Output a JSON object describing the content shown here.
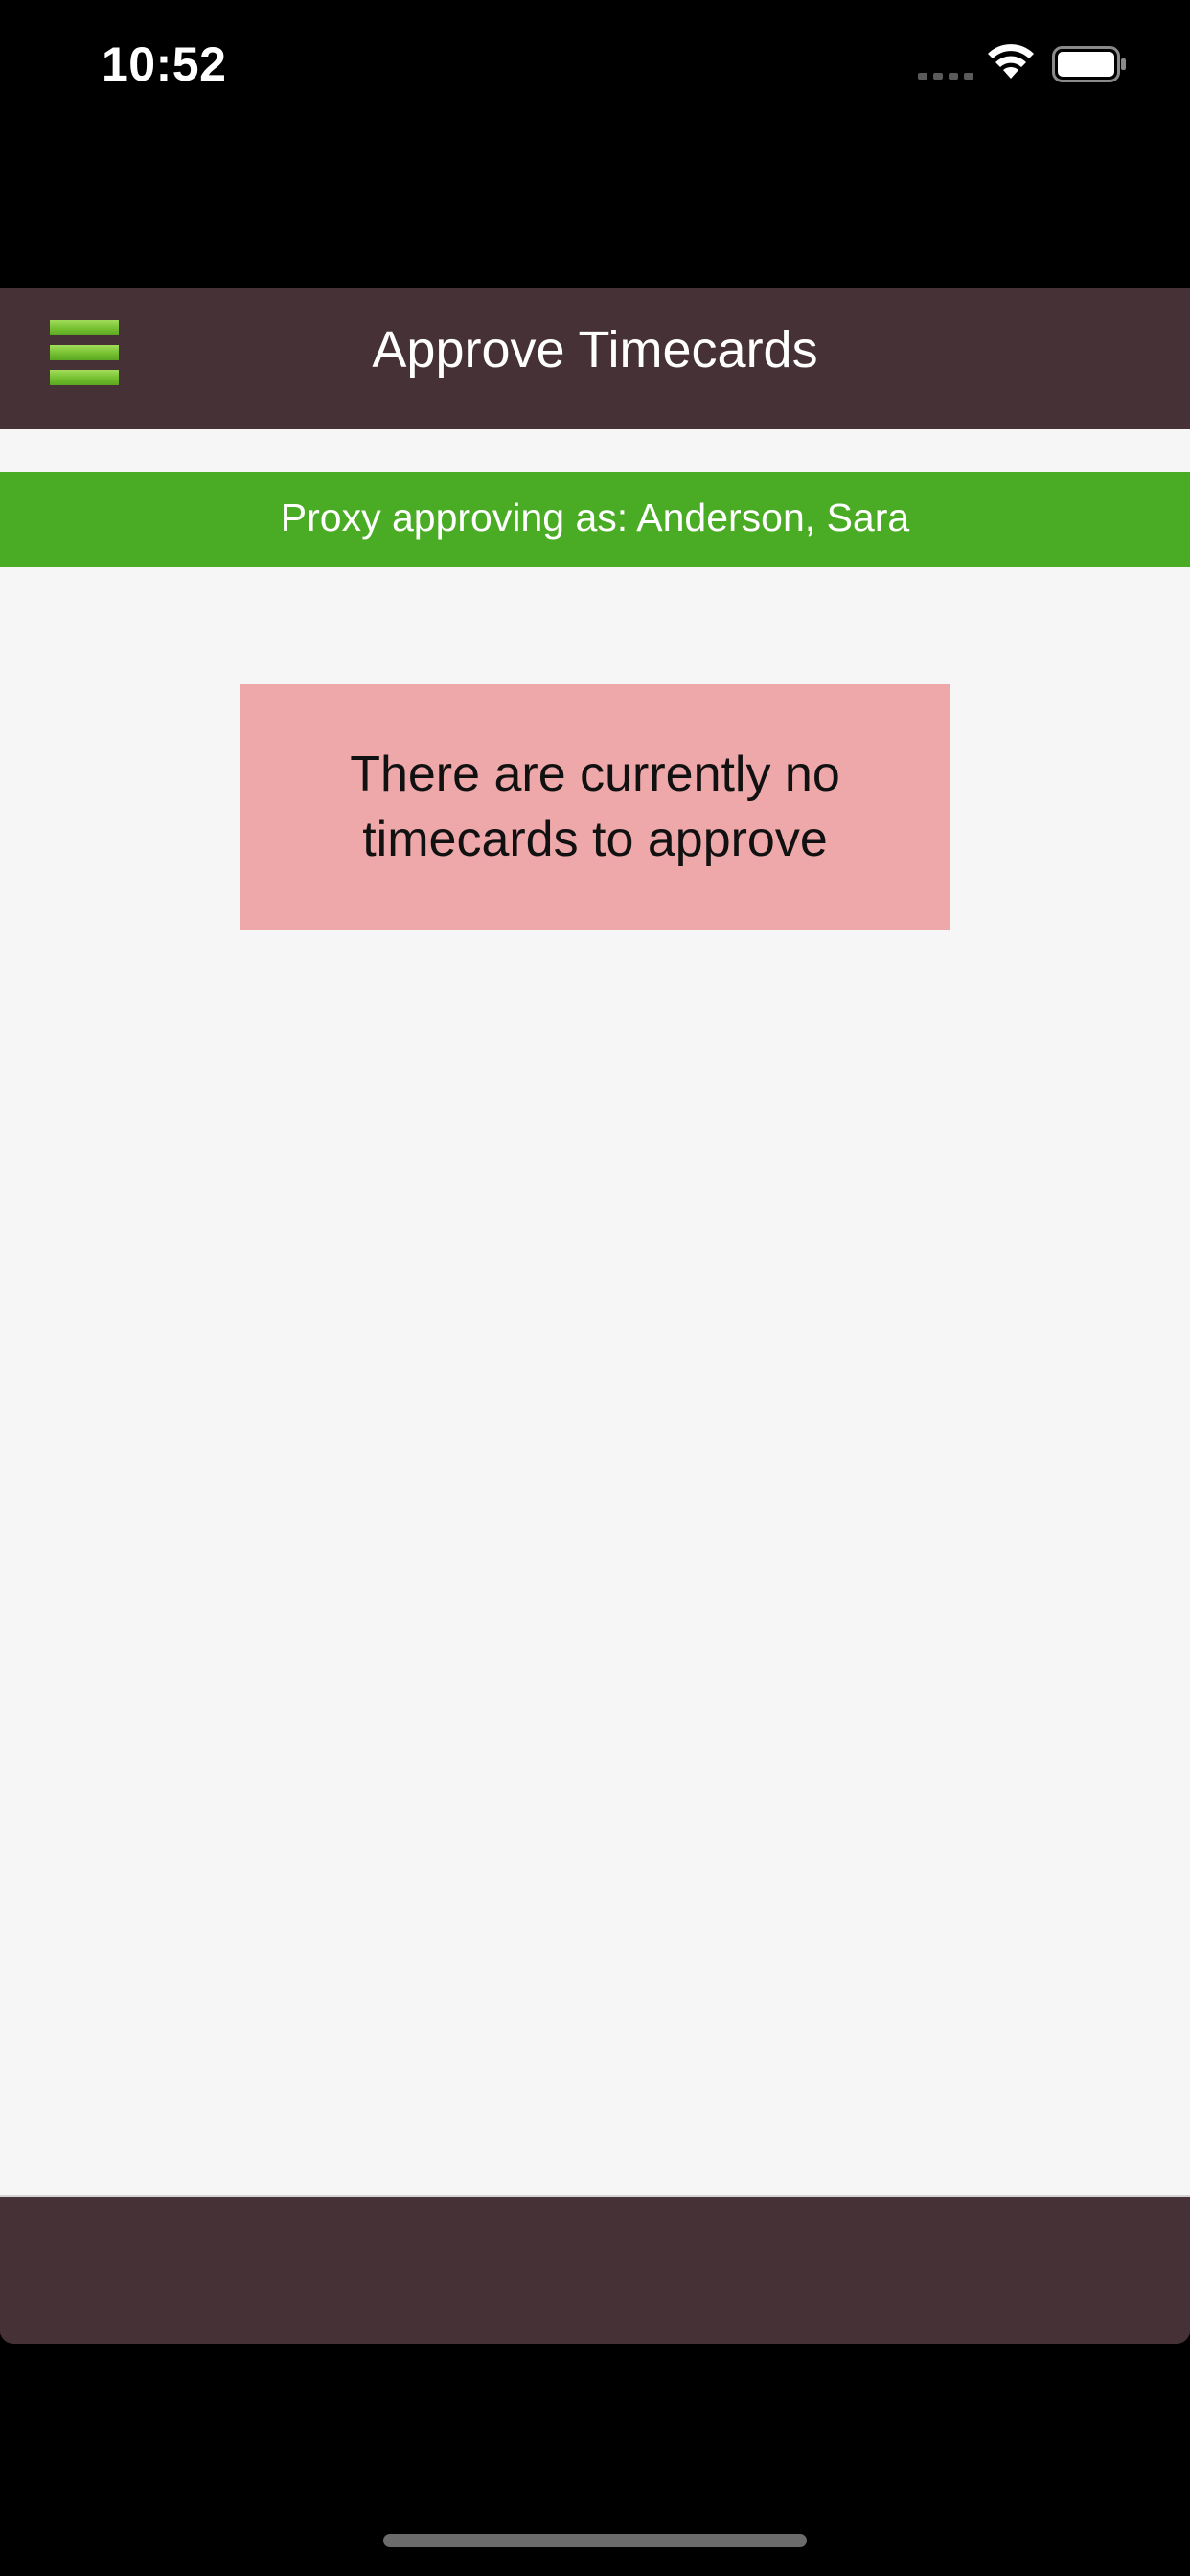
{
  "status_bar": {
    "time": "10:52",
    "icons": [
      "cellular-signal-icon",
      "wifi-icon",
      "battery-icon"
    ]
  },
  "header": {
    "title": "Approve Timecards",
    "menu_icon": "hamburger-menu-icon"
  },
  "proxy_banner": {
    "text": "Proxy approving as: Anderson, Sara"
  },
  "empty_state": {
    "message": "There are currently no timecards to approve"
  },
  "colors": {
    "header_bg": "#453136",
    "banner_bg": "#4aac24",
    "message_bg": "#eea8a9",
    "content_bg": "#f6f6f6",
    "menu_icon": "#74c030"
  }
}
